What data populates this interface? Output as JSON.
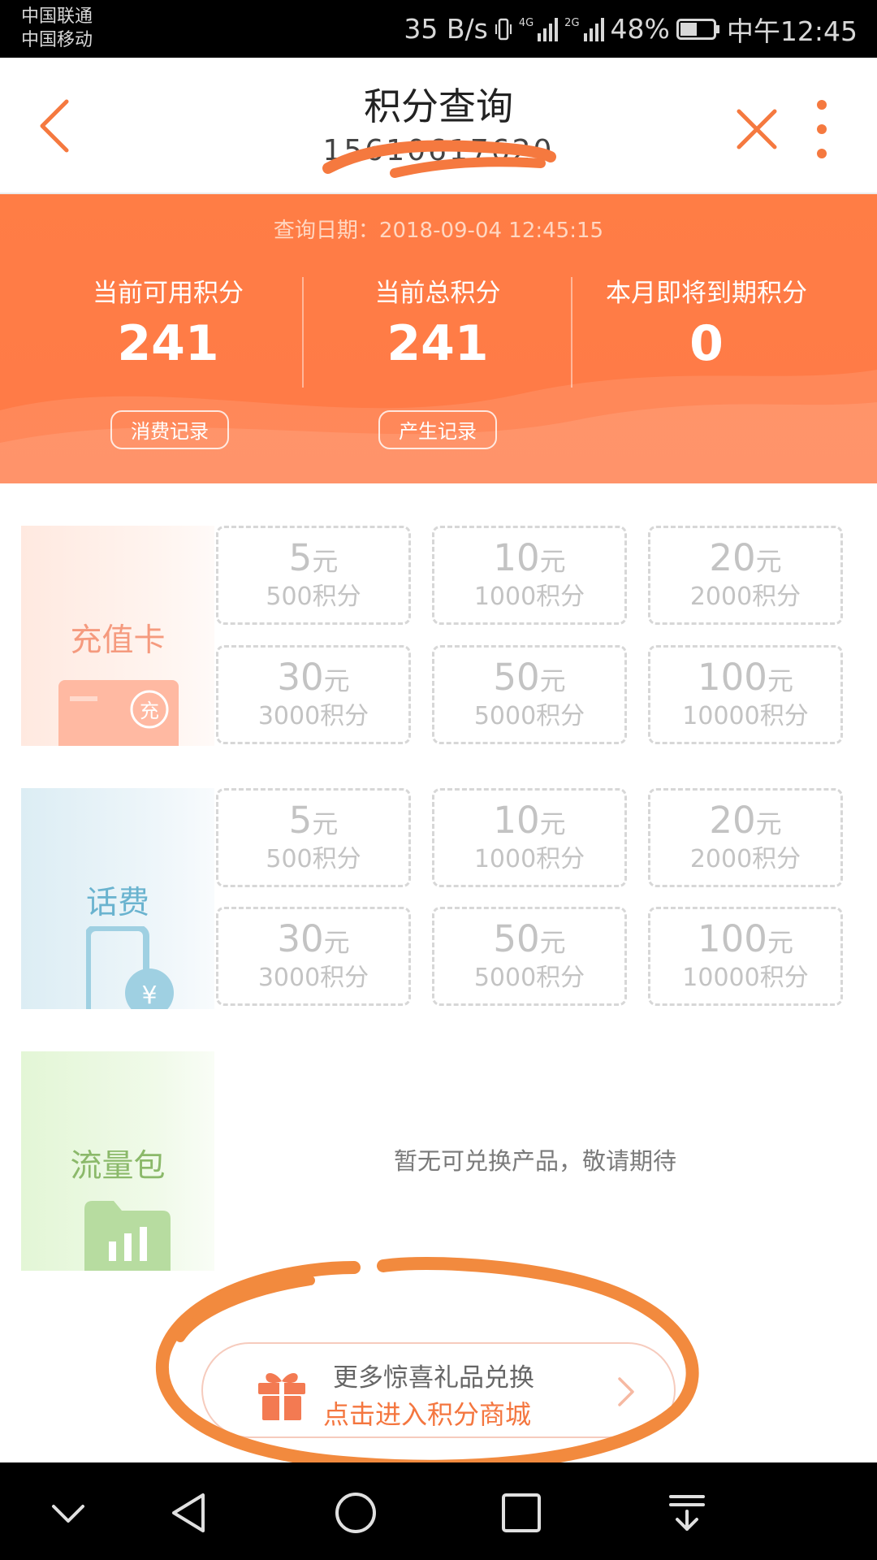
{
  "status_bar": {
    "carrier_1": "中国联通",
    "carrier_2": "中国移动",
    "net_speed": "35 B/s",
    "sig1_tag": "4G",
    "sig2_tag": "2G",
    "battery": "48%",
    "time": "中午12:45"
  },
  "header": {
    "title": "积分查询",
    "phone": "15610617620",
    "accent": "#f5793f"
  },
  "banner": {
    "query_date": "查询日期：2018-09-04 12:45:15",
    "stats": [
      {
        "label": "当前可用积分",
        "value": "241"
      },
      {
        "label": "当前总积分",
        "value": "241"
      },
      {
        "label": "本月即将到期积分",
        "value": "0"
      }
    ],
    "consume_record": "消费记录",
    "earn_record": "产生记录"
  },
  "sections": [
    {
      "name": "充值卡",
      "icon": "recharge-card-icon",
      "icon_text": "充",
      "tiles": [
        {
          "amount": "5",
          "unit": "元",
          "points": "500积分"
        },
        {
          "amount": "10",
          "unit": "元",
          "points": "1000积分"
        },
        {
          "amount": "20",
          "unit": "元",
          "points": "2000积分"
        },
        {
          "amount": "30",
          "unit": "元",
          "points": "3000积分"
        },
        {
          "amount": "50",
          "unit": "元",
          "points": "5000积分"
        },
        {
          "amount": "100",
          "unit": "元",
          "points": "10000积分"
        }
      ]
    },
    {
      "name": "话费",
      "icon": "phone-bill-icon",
      "icon_text": "¥",
      "tiles": [
        {
          "amount": "5",
          "unit": "元",
          "points": "500积分"
        },
        {
          "amount": "10",
          "unit": "元",
          "points": "1000积分"
        },
        {
          "amount": "20",
          "unit": "元",
          "points": "2000积分"
        },
        {
          "amount": "30",
          "unit": "元",
          "points": "3000积分"
        },
        {
          "amount": "50",
          "unit": "元",
          "points": "5000积分"
        },
        {
          "amount": "100",
          "unit": "元",
          "points": "10000积分"
        }
      ]
    },
    {
      "name": "流量包",
      "icon": "data-package-icon",
      "empty_text": "暂无可兑换产品，敬请期待"
    }
  ],
  "mall": {
    "line1": "更多惊喜礼品兑换",
    "line2": "点击进入积分商城"
  },
  "colors": {
    "orange": "#ff7a46",
    "recharge_text": "#f59a7e",
    "bill_text": "#6ab3cf",
    "data_text": "#8bb96a"
  }
}
